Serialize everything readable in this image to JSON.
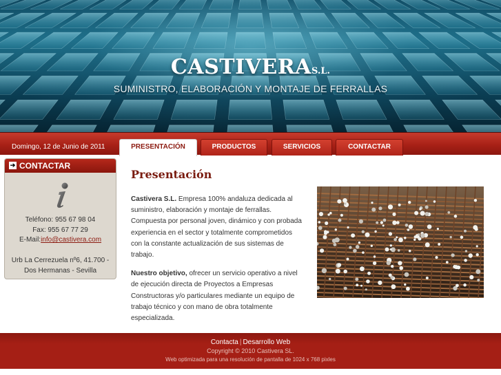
{
  "header": {
    "brand_name": "CASTIVERA",
    "brand_suffix": "S.L.",
    "tagline": "SUMINISTRO, ELABORACIÓN Y MONTAJE DE FERRALLAS"
  },
  "navbar": {
    "date": "Domingo, 12 de Junio de 2011",
    "tabs": [
      {
        "label": "PRESENTACIÓN",
        "active": true
      },
      {
        "label": "PRODUCTOS",
        "active": false
      },
      {
        "label": "SERVICIOS",
        "active": false
      },
      {
        "label": "CONTACTAR",
        "active": false
      }
    ]
  },
  "sidebar": {
    "title": "CONTACTAR",
    "arrow_icon": "arrow-right-icon",
    "info_icon": "info-icon",
    "telefono": "Teléfono: 955 67 98 04",
    "fax": "Fax: 955 67 77 29",
    "email_label": "E-Mail:",
    "email": "info@castivera.com",
    "address_line1": "Urb La Cerrezuela nº6, 41.700 -",
    "address_line2": "Dos Hermanas - Sevilla"
  },
  "main": {
    "title": "Presentación",
    "p1_bold": "Castivera S.L.",
    "p1_text": " Empresa 100% andaluza dedicada al suministro, elaboración y montaje de ferrallas. Compuesta por personal joven, dinámico y con probada experiencia en el sector y totalmente comprometidos con la constante actualización de sus sistemas de trabajo.",
    "p2_bold": "Nuestro objetivo,",
    "p2_text": " ofrecer un servicio operativo a nivel de ejecución directa de Proyectos a Empresas Constructoras y/o particulares mediante un equipo de trabajo técnico y con mano de obra totalmente especializada."
  },
  "footer": {
    "link1": "Contacta",
    "separator": "|",
    "link2": "Desarrollo Web",
    "copyright": "Copyright © 2010 Castivera SL.",
    "note": "Web optimizada para una resolución de pantalla de 1024 x 768 pixles"
  },
  "colors": {
    "accent_red": "#a51f15",
    "header_teal": "#1d6e88",
    "sidebar_bg": "#ddd8cf"
  }
}
